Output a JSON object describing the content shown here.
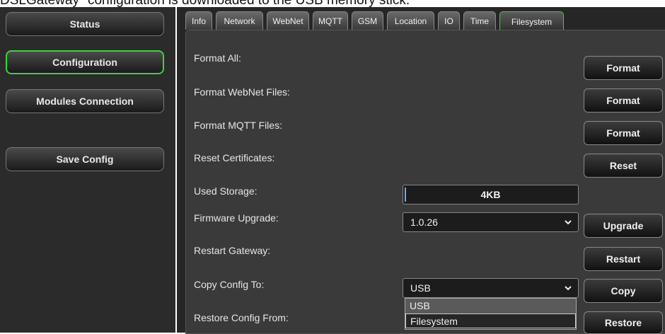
{
  "caption": "DSLGateway\" configuration is downloaded to the USB memory stick.",
  "sidebar": {
    "items": [
      {
        "label": "Status"
      },
      {
        "label": "Configuration"
      },
      {
        "label": "Modules Connection"
      },
      {
        "label": "Save Config"
      }
    ],
    "active": "Configuration",
    "accent": "#3bd33b"
  },
  "tabs": [
    {
      "label": "Info"
    },
    {
      "label": "Network"
    },
    {
      "label": "WebNet"
    },
    {
      "label": "MQTT"
    },
    {
      "label": "GSM"
    },
    {
      "label": "Location"
    },
    {
      "label": "IO"
    },
    {
      "label": "Time"
    },
    {
      "label": "Filesystem"
    }
  ],
  "active_tab": "Filesystem",
  "rows": {
    "format_all": {
      "label": "Format All:",
      "button": "Format"
    },
    "format_webnet": {
      "label": "Format WebNet Files:",
      "button": "Format"
    },
    "format_mqtt": {
      "label": "Format MQTT Files:",
      "button": "Format"
    },
    "reset_certs": {
      "label": "Reset Certificates:",
      "button": "Reset"
    },
    "used_storage": {
      "label": "Used Storage:",
      "value": "4KB"
    },
    "firmware": {
      "label": "Firmware Upgrade:",
      "value": "1.0.26",
      "button": "Upgrade"
    },
    "restart": {
      "label": "Restart Gateway:",
      "button": "Restart"
    },
    "copy_config": {
      "label": "Copy Config To:",
      "value": "USB",
      "button": "Copy"
    },
    "restore_config": {
      "label": "Restore Config From:",
      "button": "Restore"
    }
  },
  "dropdown": {
    "options": [
      "USB",
      "Filesystem"
    ],
    "selected": "USB",
    "hovered": "Filesystem"
  }
}
